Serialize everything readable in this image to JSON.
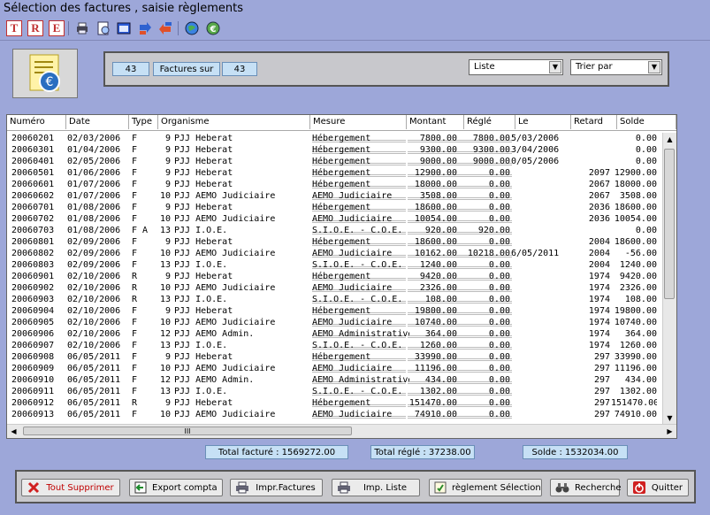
{
  "window": {
    "title": "Sélection des factures , saisie règlements"
  },
  "toolbar": {
    "t_label": "T",
    "r_label": "R",
    "e_label": "E"
  },
  "filters": {
    "count_left": "43",
    "factures_sur_label": "Factures sur",
    "count_right": "43",
    "list_value": "Liste",
    "sort_value": "Trier par"
  },
  "table": {
    "columns": [
      "Numéro",
      "Date",
      "Type",
      "Organisme",
      "Mesure",
      "Montant",
      "Réglé",
      "Le",
      "Retard",
      "Solde"
    ],
    "rows": [
      [
        "20060201",
        "02/03/2006",
        "F",
        "9",
        "PJJ Heberat",
        "Hébergement",
        "7800.00",
        "7800.00",
        "5/03/2006",
        "",
        "0.00"
      ],
      [
        "20060301",
        "01/04/2006",
        "F",
        "9",
        "PJJ Heberat",
        "Hébergement",
        "9300.00",
        "9300.00",
        "3/04/2006",
        "",
        "0.00"
      ],
      [
        "20060401",
        "02/05/2006",
        "F",
        "9",
        "PJJ Heberat",
        "Hébergement",
        "9000.00",
        "9000.00",
        "0/05/2006",
        "",
        "0.00"
      ],
      [
        "20060501",
        "01/06/2006",
        "F",
        "9",
        "PJJ Heberat",
        "Hébergement",
        "12900.00",
        "0.00",
        "",
        "2097",
        "12900.00"
      ],
      [
        "20060601",
        "01/07/2006",
        "F",
        "9",
        "PJJ Heberat",
        "Hébergement",
        "18000.00",
        "0.00",
        "",
        "2067",
        "18000.00"
      ],
      [
        "20060602",
        "01/07/2006",
        "F",
        "10",
        "PJJ AEMO Judiciaire",
        "AEMO Judiciaire",
        "3508.00",
        "0.00",
        "",
        "2067",
        "3508.00"
      ],
      [
        "20060701",
        "01/08/2006",
        "F",
        "9",
        "PJJ Heberat",
        "Hébergement",
        "18600.00",
        "0.00",
        "",
        "2036",
        "18600.00"
      ],
      [
        "20060702",
        "01/08/2006",
        "F",
        "10",
        "PJJ AEMO Judiciaire",
        "AEMO Judiciaire",
        "10054.00",
        "0.00",
        "",
        "2036",
        "10054.00"
      ],
      [
        "20060703",
        "01/08/2006",
        "F A",
        "13",
        "PJJ I.O.E.",
        "S.I.O.E. - C.O.E.",
        "920.00",
        "920.00",
        "",
        "",
        "0.00"
      ],
      [
        "20060801",
        "02/09/2006",
        "F",
        "9",
        "PJJ Heberat",
        "Hébergement",
        "18600.00",
        "0.00",
        "",
        "2004",
        "18600.00"
      ],
      [
        "20060802",
        "02/09/2006",
        "F",
        "10",
        "PJJ AEMO Judiciaire",
        "AEMO Judiciaire",
        "10162.00",
        "10218.00",
        "6/05/2011",
        "2004",
        "-56.00"
      ],
      [
        "20060803",
        "02/09/2006",
        "F",
        "13",
        "PJJ I.O.E.",
        "S.I.O.E. - C.O.E.",
        "1240.00",
        "0.00",
        "",
        "2004",
        "1240.00"
      ],
      [
        "20060901",
        "02/10/2006",
        "R",
        "9",
        "PJJ Heberat",
        "Hébergement",
        "9420.00",
        "0.00",
        "",
        "1974",
        "9420.00"
      ],
      [
        "20060902",
        "02/10/2006",
        "R",
        "10",
        "PJJ AEMO Judiciaire",
        "AEMO Judiciaire",
        "2326.00",
        "0.00",
        "",
        "1974",
        "2326.00"
      ],
      [
        "20060903",
        "02/10/2006",
        "R",
        "13",
        "PJJ I.O.E.",
        "S.I.O.E. - C.O.E.",
        "108.00",
        "0.00",
        "",
        "1974",
        "108.00"
      ],
      [
        "20060904",
        "02/10/2006",
        "F",
        "9",
        "PJJ Heberat",
        "Hébergement",
        "19800.00",
        "0.00",
        "",
        "1974",
        "19800.00"
      ],
      [
        "20060905",
        "02/10/2006",
        "F",
        "10",
        "PJJ AEMO Judiciaire",
        "AEMO Judiciaire",
        "10740.00",
        "0.00",
        "",
        "1974",
        "10740.00"
      ],
      [
        "20060906",
        "02/10/2006",
        "F",
        "12",
        "PJJ AEMO Admin.",
        "AEMO Administrative",
        "364.00",
        "0.00",
        "",
        "1974",
        "364.00"
      ],
      [
        "20060907",
        "02/10/2006",
        "F",
        "13",
        "PJJ I.O.E.",
        "S.I.O.E. - C.O.E.",
        "1260.00",
        "0.00",
        "",
        "1974",
        "1260.00"
      ],
      [
        "20060908",
        "06/05/2011",
        "F",
        "9",
        "PJJ Heberat",
        "Hébergement",
        "33990.00",
        "0.00",
        "",
        "297",
        "33990.00"
      ],
      [
        "20060909",
        "06/05/2011",
        "F",
        "10",
        "PJJ AEMO Judiciaire",
        "AEMO Judiciaire",
        "11196.00",
        "0.00",
        "",
        "297",
        "11196.00"
      ],
      [
        "20060910",
        "06/05/2011",
        "F",
        "12",
        "PJJ AEMO Admin.",
        "AEMO Administrative",
        "434.00",
        "0.00",
        "",
        "297",
        "434.00"
      ],
      [
        "20060911",
        "06/05/2011",
        "F",
        "13",
        "PJJ I.O.E.",
        "S.I.O.E. - C.O.E.",
        "1302.00",
        "0.00",
        "",
        "297",
        "1302.00"
      ],
      [
        "20060912",
        "06/05/2011",
        "R",
        "9",
        "PJJ Heberat",
        "Hébergement",
        "151470.00",
        "0.00",
        "",
        "297",
        "151470.00"
      ],
      [
        "20060913",
        "06/05/2011",
        "F",
        "10",
        "PJJ AEMO Judiciaire",
        "AEMO Judiciaire",
        "74910.00",
        "0.00",
        "",
        "297",
        "74910.00"
      ]
    ],
    "hscroll_thumb_label": "III"
  },
  "totals": {
    "facture": "Total facturé : 1569272.00",
    "regle": "Total réglé : 37238.00",
    "solde": "Solde : 1532034.00"
  },
  "buttons": {
    "delete_all": "Tout Supprimer",
    "export": "Export compta",
    "print_invoices": "Impr.Factures",
    "print_list": "Imp. Liste",
    "payment": "règlement Sélection",
    "search": "Recherche",
    "quit": "Quitter"
  },
  "colors": {
    "background": "#9da7d9",
    "panel": "#c8c8cc",
    "total_box": "#c6e0f5",
    "delete_text": "#c00000"
  }
}
